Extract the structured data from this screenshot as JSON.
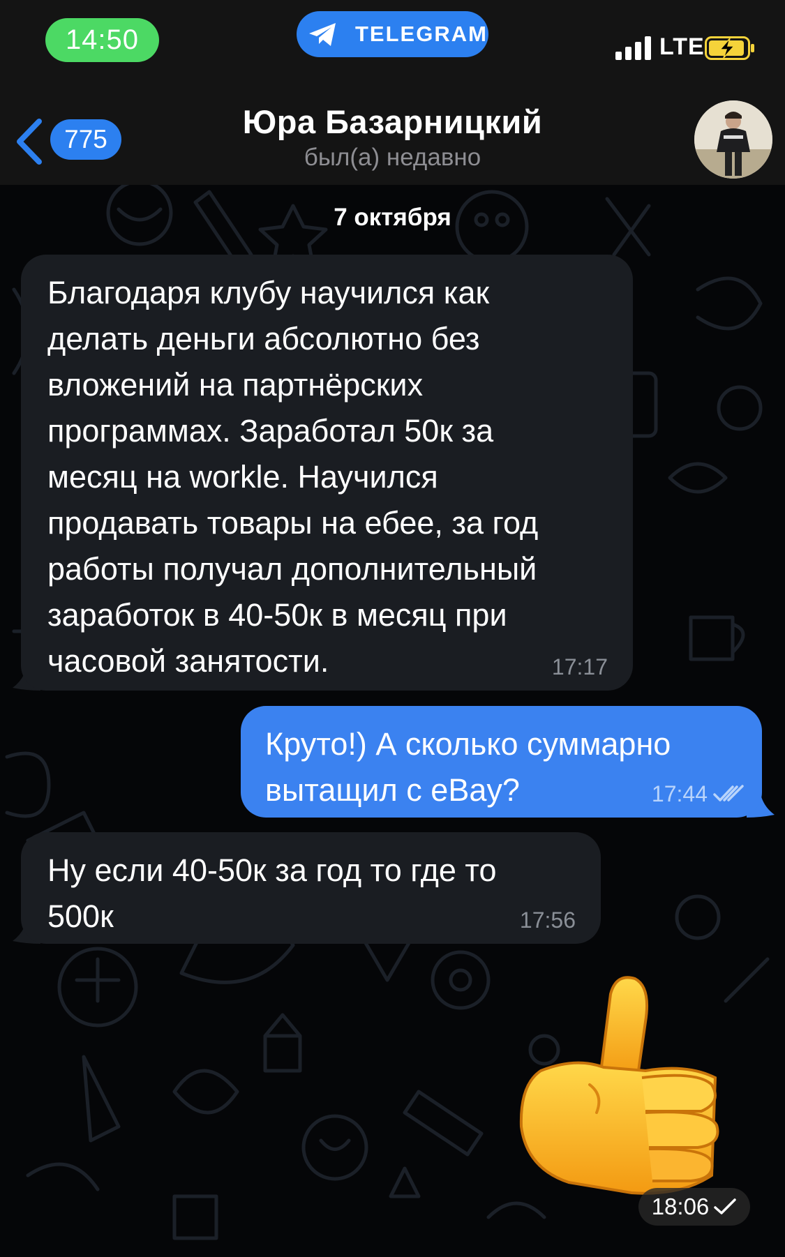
{
  "status_bar": {
    "time": "14:50",
    "app_label": "TELEGRAM",
    "network": "LTE"
  },
  "header": {
    "back_count": "775",
    "name": "Юра Базарницкий",
    "status": "был(а) недавно"
  },
  "chat": {
    "date": "7 октября",
    "messages": [
      {
        "direction": "incoming",
        "text": "Благодаря клубу научился как\nделать деньги абсолютно без\nвложений на партнёрских\nпрограммах. Заработал 50к за\nмесяц на workle. Научился\nпродавать товары на ебее, за год\nработы получал дополнительный\nзаработок в 40-50к в месяц при\nчасовой занятости.",
        "time": "17:17"
      },
      {
        "direction": "outgoing",
        "text": "Круто!) А сколько суммарно\nвытащил с eBay?",
        "time": "17:44",
        "status": "read"
      },
      {
        "direction": "incoming",
        "text": "Ну если 40-50к за год то где то\n500к",
        "time": "17:56"
      },
      {
        "direction": "outgoing",
        "sticker": "thumbs-up",
        "time": "18:06",
        "status": "sent"
      }
    ]
  },
  "colors": {
    "accent": "#2c80f0",
    "outgoing_bubble": "#3b82f0",
    "incoming_bubble": "#1a1d22",
    "time_pill": "#4cd964",
    "battery_charging": "#f5d33a"
  },
  "icons": [
    "telegram-plane-icon",
    "signal-bars-icon",
    "battery-charging-icon",
    "back-chevron-icon",
    "double-check-icon",
    "check-icon",
    "thumbs-up-sticker"
  ]
}
